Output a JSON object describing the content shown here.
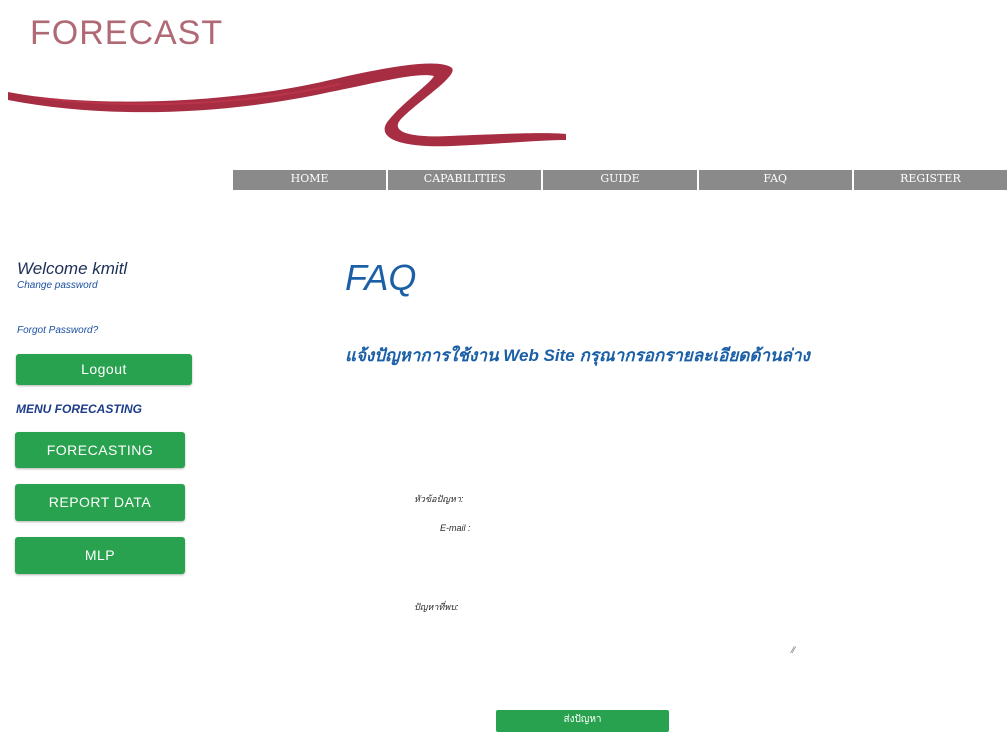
{
  "brand": {
    "logo_text": "FORECAST",
    "swoosh_color": "#9e1b32"
  },
  "nav": [
    "HOME",
    "CAPABILITIES",
    "GUIDE",
    "FAQ",
    "REGISTER"
  ],
  "sidebar": {
    "welcome": "Welcome kmitl",
    "change_password": "Change password",
    "forgot_password": "Forgot Password?",
    "logout": "Logout",
    "menu_heading": "MENU FORECASTING",
    "menu_items": [
      "FORECASTING",
      "REPORT DATA",
      "MLP"
    ]
  },
  "main": {
    "title": "FAQ",
    "subtitle": "แจ้งปัญหาการใช้งาน Web Site กรุณากรอกรายละเอียดด้านล่าง",
    "form": {
      "subject_label": "หัวข้อปัญหา:",
      "email_label": "E-mail :",
      "problem_label": "ปัญหาที่พบ:",
      "submit_label": "ส่งปัญหา"
    }
  },
  "colors": {
    "accent_green": "#28a24e",
    "nav_gray": "#8a8a8a",
    "title_blue": "#1b5fa6"
  }
}
